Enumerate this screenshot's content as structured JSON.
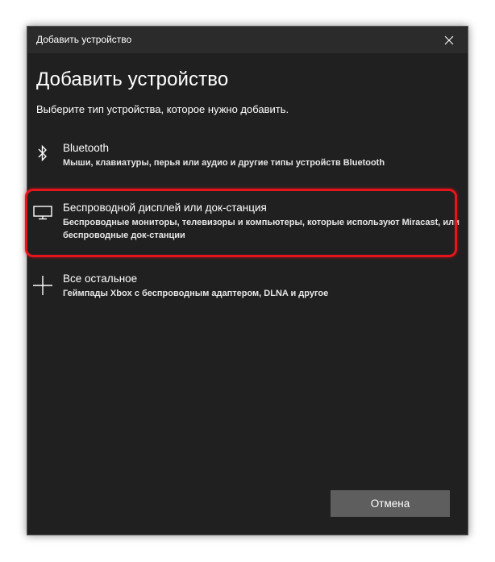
{
  "window": {
    "title": "Добавить устройство"
  },
  "dialog": {
    "heading": "Добавить устройство",
    "subtitle": "Выберите тип устройства, которое нужно добавить."
  },
  "options": [
    {
      "icon": "bluetooth-icon",
      "title": "Bluetooth",
      "description": "Мыши, клавиатуры, перья или аудио и другие типы устройств Bluetooth"
    },
    {
      "icon": "monitor-icon",
      "title": "Беспроводной дисплей или док-станция",
      "description": "Беспроводные мониторы, телевизоры и компьютеры, которые используют Miracast, или беспроводные док-станции"
    },
    {
      "icon": "plus-icon",
      "title": "Все остальное",
      "description": "Геймпады Xbox с беспроводным адаптером, DLNA и другое"
    }
  ],
  "buttons": {
    "cancel_label": "Отмена"
  },
  "colors": {
    "background": "#202020",
    "titlebar": "#2b2b2b",
    "highlight": "#e8141b",
    "button": "#5e5e5e"
  }
}
